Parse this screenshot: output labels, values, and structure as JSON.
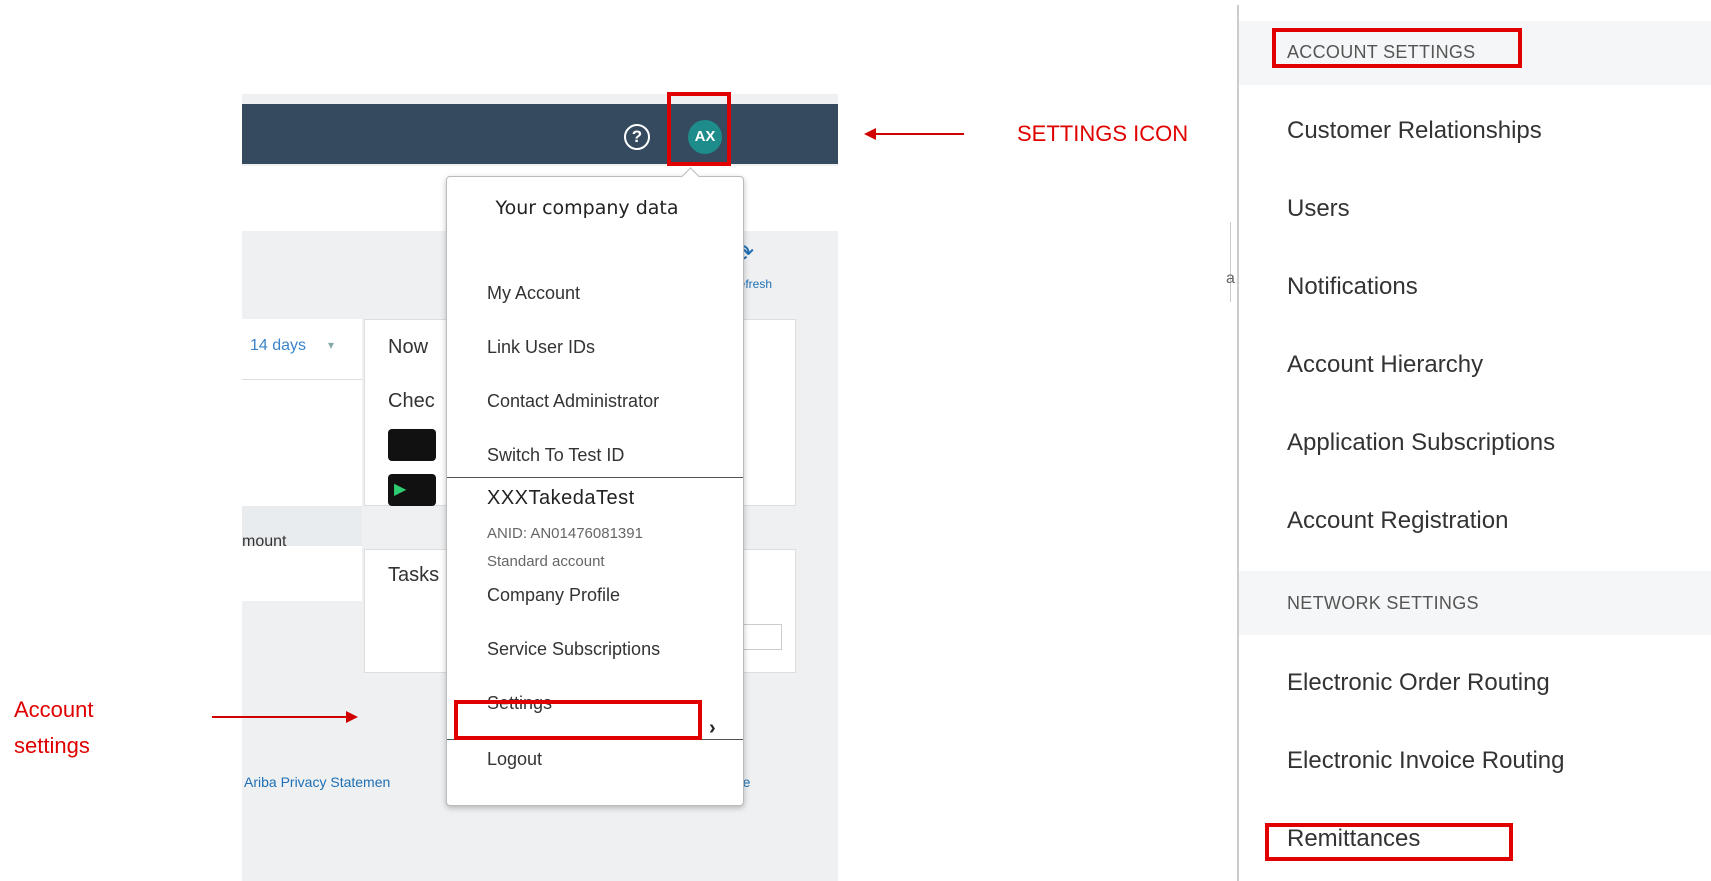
{
  "topbar": {
    "help_icon": "?",
    "avatar_initials": "AX"
  },
  "subbar": {
    "refresh_label": "Refresh"
  },
  "dashboard": {
    "days_select": "14 days",
    "amount_label": "mount",
    "now_title": "Now",
    "check_text": "Chec",
    "tasks_title": "Tasks"
  },
  "footer": {
    "privacy": "Ariba Privacy Statemen",
    "terms": "of Use"
  },
  "menu": {
    "company_data": "Your company data",
    "items": [
      {
        "label": "My Account"
      },
      {
        "label": "Link User IDs"
      },
      {
        "label": "Contact Administrator"
      },
      {
        "label": "Switch To Test ID"
      }
    ],
    "company_name": "XXXTakedaTest",
    "anid": "ANID: AN01476081391",
    "account_type": "Standard account",
    "company_profile": "Company Profile",
    "service_subscriptions": "Service Subscriptions",
    "settings": "Settings",
    "logout": "Logout"
  },
  "annotations": {
    "settings_icon": "SETTINGS ICON",
    "account_settings_line1": "Account",
    "account_settings_line2": "settings"
  },
  "panel": {
    "account_settings_title": "ACCOUNT SETTINGS",
    "account_items": [
      "Customer Relationships",
      "Users",
      "Notifications",
      "Account Hierarchy",
      "Application Subscriptions",
      "Account Registration"
    ],
    "network_settings_title": "NETWORK SETTINGS",
    "network_items": [
      "Electronic Order Routing",
      "Electronic Invoice Routing",
      "Remittances"
    ],
    "stub_letter": "a"
  },
  "colors": {
    "annotation_red": "#e00000",
    "topbar": "#354a5f",
    "avatar": "#1e8c8a",
    "link": "#1e6fb5"
  }
}
